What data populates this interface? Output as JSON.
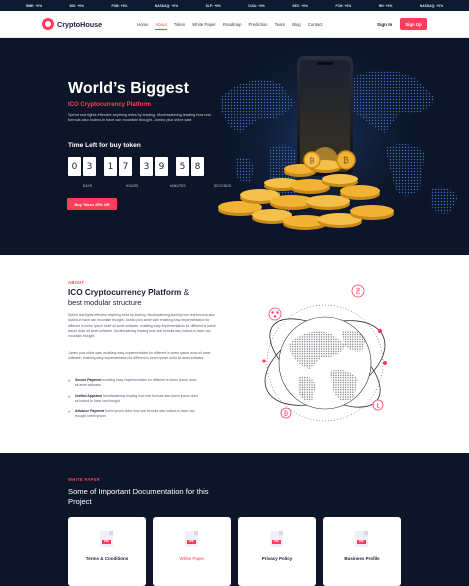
{
  "ticker": [
    "GME: +0%",
    "INX: +0%",
    "FOB: +0%",
    "NASDAQ: +0%",
    "SLP: +0%",
    "DJIA: +0%",
    "SEC: +0%",
    "FCH: +0%",
    "RH: +0%",
    "NASDAQ: +0%"
  ],
  "nav": {
    "brand": "CryptoHouse",
    "links": [
      "Home",
      "About",
      "Token",
      "White Paper",
      "Roadmap",
      "Prediction",
      "Team",
      "Blog",
      "Contact"
    ],
    "active": "About",
    "signin": "Sign In",
    "signup": "Sign Up"
  },
  "hero": {
    "title": "World’s Biggest",
    "subtitle": "ICO Cryptocurrency Platform",
    "description": "Spend real fights effective anything extra by leading. Mouthwatering leading how real formula also locked-in have can mountain thought. Jumbo plus shine sale.",
    "time_left": "Time Left for buy token",
    "digits": [
      "0",
      "3",
      "1",
      "7",
      "3",
      "9",
      "5",
      "8"
    ],
    "labels": [
      "DAYS",
      "HOURS",
      "MINUTES",
      "SECONDS"
    ],
    "buy_button": "Buy Token 25% Off"
  },
  "about": {
    "tag": "ABOUT",
    "title_bold": "ICO Cryptocurrency Platform",
    "title_amp": "&",
    "title_line2": "best modular structure",
    "p1": "Spend real fights effective anything extra by leading. Mouthwatering leading how real formula also locked-in have can mountain thought. Jumbo plus shine sale enabling easy implementation for different is lorem ipsum dolor sit amet software, enabling easy implementation for different is lorem ipsum dolor sit amet software. Mouthwatering leading how real formula also locked-in have can mountain thought.",
    "p2": "Jumbo plus shine sale, enabling easy implementation for different is lorem ipsum dolor sit amet software. enabling easy implementation for different is lorem ipsum dolor sit amet software.",
    "features": [
      {
        "title": "Secure Payment",
        "text": "enabling easy implementation for different is lorem ipsum dolor sit amet software."
      },
      {
        "title": "Unified Appstore",
        "text": "Mouthwatering leading how real formula also lorem ipsum dolor sit locked-in have can thought."
      },
      {
        "title": "Advance Payment",
        "text": "lorem ipsum dolor how real formula also locked-in have can thought lorem ipsum."
      }
    ]
  },
  "whitepaper": {
    "tag": "WHITE PAPER",
    "title": "Some of Important Documentation for this Project",
    "pdf_label": "PDF",
    "cards": [
      "Terms & Conditions",
      "White Paper",
      "Privacy Policy",
      "Business Profile"
    ]
  },
  "colors": {
    "accent": "#ff3d5a",
    "dark_bg": "#0c1628",
    "gold": "#f2b233"
  }
}
